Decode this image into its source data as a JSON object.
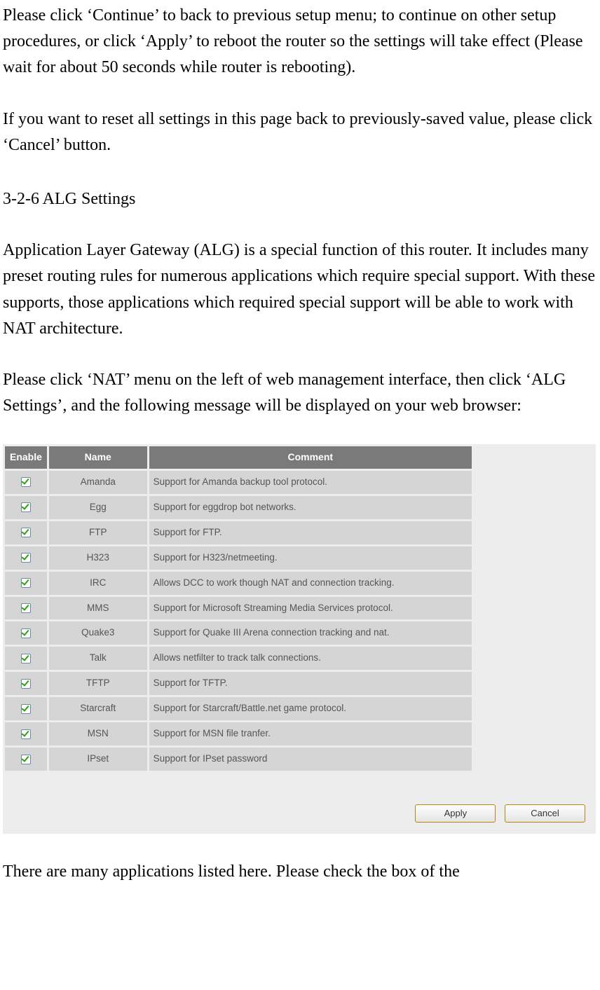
{
  "text": {
    "para1": "Please click ‘Continue’ to back to previous setup menu; to continue on other setup procedures, or click ‘Apply’ to reboot the router so the settings will take effect (Please wait for about 50 seconds while router is rebooting).",
    "para2": "If you want to reset all settings in this page back to previously-saved value, please click ‘Cancel’ button.",
    "heading": "3-2-6 ALG Settings",
    "para3": "Application Layer Gateway (ALG) is a special function of this router. It includes many preset routing rules for numerous applications which require special support. With these supports, those applications which required special support will be able to work with NAT architecture.",
    "para4": "Please click ‘NAT’ menu on the left of web management interface, then click ‘ALG Settings’, and the following message will be displayed on your web browser:",
    "para5": "There are many applications listed here. Please check the box of the"
  },
  "table": {
    "headers": {
      "enable": "Enable",
      "name": "Name",
      "comment": "Comment"
    },
    "rows": [
      {
        "enabled": true,
        "name": "Amanda",
        "comment": "Support for Amanda backup tool protocol."
      },
      {
        "enabled": true,
        "name": "Egg",
        "comment": "Support for eggdrop bot networks."
      },
      {
        "enabled": true,
        "name": "FTP",
        "comment": "Support for FTP."
      },
      {
        "enabled": true,
        "name": "H323",
        "comment": "Support for H323/netmeeting."
      },
      {
        "enabled": true,
        "name": "IRC",
        "comment": " Allows DCC to work though NAT and connection tracking."
      },
      {
        "enabled": true,
        "name": "MMS",
        "comment": " Support for Microsoft Streaming Media Services protocol."
      },
      {
        "enabled": true,
        "name": "Quake3",
        "comment": "Support for Quake III Arena connection tracking and nat."
      },
      {
        "enabled": true,
        "name": "Talk",
        "comment": "Allows netfilter to track talk connections."
      },
      {
        "enabled": true,
        "name": "TFTP",
        "comment": "Support for TFTP."
      },
      {
        "enabled": true,
        "name": "Starcraft",
        "comment": "Support for Starcraft/Battle.net game protocol."
      },
      {
        "enabled": true,
        "name": "MSN",
        "comment": "Support for MSN file tranfer."
      },
      {
        "enabled": true,
        "name": "IPset",
        "comment": "Support for IPset password"
      }
    ]
  },
  "buttons": {
    "apply": "Apply",
    "cancel": "Cancel"
  }
}
